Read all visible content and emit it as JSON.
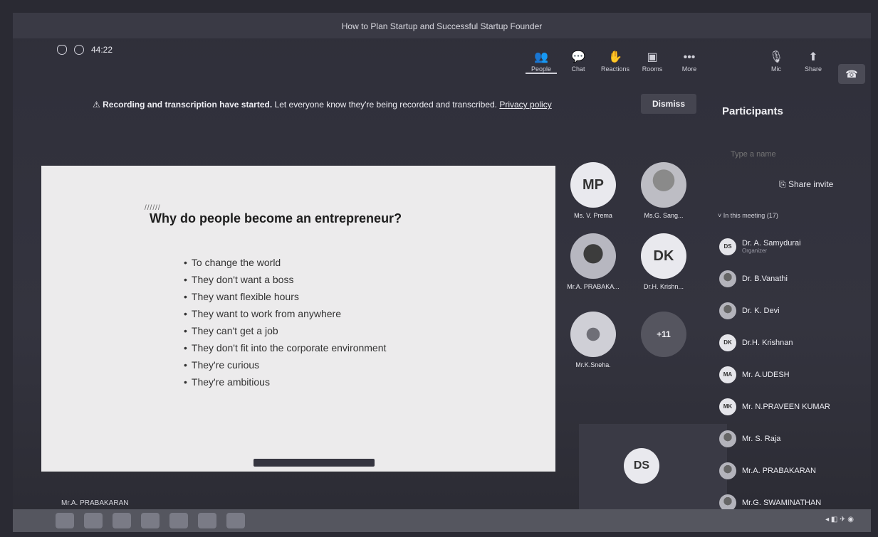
{
  "window": {
    "title": "How to Plan Startup and Successful Startup Founder"
  },
  "meeting": {
    "timer": "44:22"
  },
  "toolbar": [
    {
      "label": "People",
      "icon": "people-icon",
      "glyph": "👥"
    },
    {
      "label": "Chat",
      "icon": "chat-icon",
      "glyph": "💬"
    },
    {
      "label": "Reactions",
      "icon": "reactions-icon",
      "glyph": "✋"
    },
    {
      "label": "Rooms",
      "icon": "rooms-icon",
      "glyph": "▣"
    },
    {
      "label": "More",
      "icon": "more-icon",
      "glyph": "•••"
    },
    {
      "label": "Mic",
      "icon": "mic-icon",
      "glyph": "🎙"
    },
    {
      "label": "Share",
      "icon": "share-icon",
      "glyph": "⬆"
    }
  ],
  "banner": {
    "bold": "Recording and transcription have started.",
    "text": "Let everyone know they're being recorded and transcribed.",
    "link": "Privacy policy",
    "dismiss": "Dismiss"
  },
  "slide": {
    "mark": "//////",
    "title": "Why do people become an entrepreneur?",
    "bullets": [
      "To change the world",
      "They don't want a boss",
      "They want flexible hours",
      "They want to work from anywhere",
      "They can't get a job",
      "They don't fit into the corporate environment",
      "They're curious",
      "They're ambitious"
    ]
  },
  "presenter": "Mr.A. PRABAKARAN",
  "tiles": [
    {
      "initials": "MP",
      "name": "Ms. V. Prema"
    },
    {
      "initials": "",
      "name": "Ms.G. Sang..."
    },
    {
      "initials": "",
      "name": "Mr.A. PRABAKA..."
    },
    {
      "initials": "DK",
      "name": "Dr.H. Krishn..."
    },
    {
      "initials": "",
      "name": "Mr.K.Sneha."
    },
    {
      "initials": "+11",
      "name": ""
    }
  ],
  "ds_tile": {
    "initials": "DS"
  },
  "participants": {
    "title": "Participants",
    "search_placeholder": "Type a name",
    "share_invite": "Share invite",
    "in_meeting": "In this meeting (17)",
    "list": [
      {
        "initials": "DS",
        "name": "Dr. A. Samydurai",
        "role": "Organizer"
      },
      {
        "initials": "",
        "name": "Dr. B.Vanathi",
        "role": ""
      },
      {
        "initials": "",
        "name": "Dr. K. Devi",
        "role": ""
      },
      {
        "initials": "DK",
        "name": "Dr.H. Krishnan",
        "role": ""
      },
      {
        "initials": "MA",
        "name": "Mr. A.UDESH",
        "role": ""
      },
      {
        "initials": "MK",
        "name": "Mr. N.PRAVEEN KUMAR",
        "role": ""
      },
      {
        "initials": "",
        "name": "Mr. S. Raja",
        "role": ""
      },
      {
        "initials": "",
        "name": "Mr.A. PRABAKARAN",
        "role": ""
      },
      {
        "initials": "",
        "name": "Mr.G. SWAMINATHAN",
        "role": ""
      }
    ]
  }
}
